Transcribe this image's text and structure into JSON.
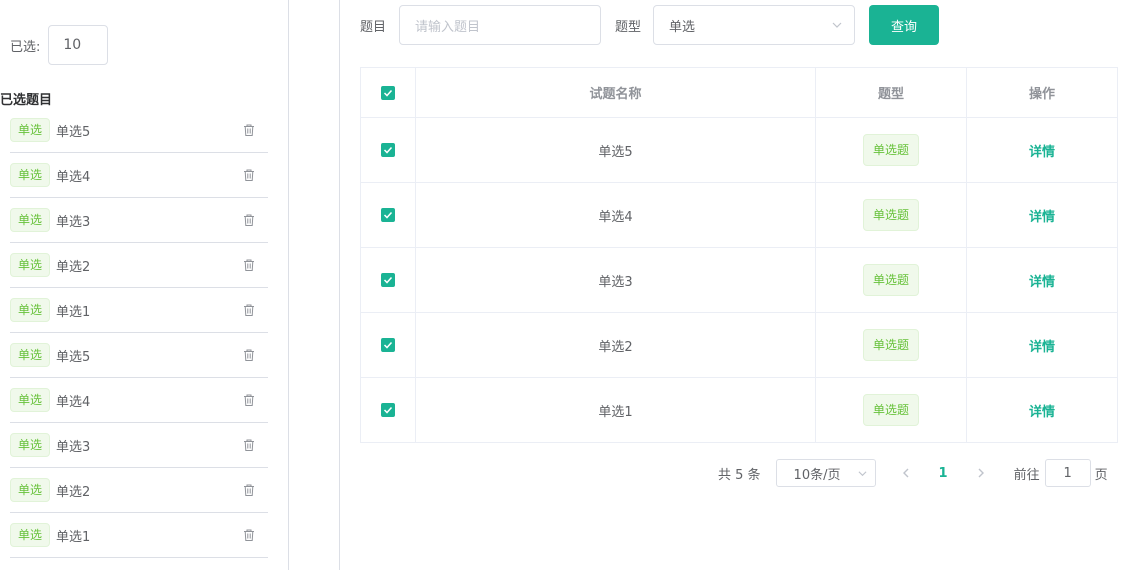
{
  "left": {
    "count_label": "已选:",
    "count_value": "10",
    "section_title": "已选题目",
    "items": [
      {
        "tag": "单选",
        "name": "单选5"
      },
      {
        "tag": "单选",
        "name": "单选4"
      },
      {
        "tag": "单选",
        "name": "单选3"
      },
      {
        "tag": "单选",
        "name": "单选2"
      },
      {
        "tag": "单选",
        "name": "单选1"
      },
      {
        "tag": "单选",
        "name": "单选5"
      },
      {
        "tag": "单选",
        "name": "单选4"
      },
      {
        "tag": "单选",
        "name": "单选3"
      },
      {
        "tag": "单选",
        "name": "单选2"
      },
      {
        "tag": "单选",
        "name": "单选1"
      }
    ]
  },
  "filter": {
    "title_label": "题目",
    "title_placeholder": "请输入题目",
    "type_label": "题型",
    "type_value": "单选",
    "query_button": "查询"
  },
  "table": {
    "columns": [
      "试题名称",
      "题型",
      "操作"
    ],
    "rows": [
      {
        "name": "单选5",
        "type": "单选题",
        "action": "详情",
        "checked": true
      },
      {
        "name": "单选4",
        "type": "单选题",
        "action": "详情",
        "checked": true
      },
      {
        "name": "单选3",
        "type": "单选题",
        "action": "详情",
        "checked": true
      },
      {
        "name": "单选2",
        "type": "单选题",
        "action": "详情",
        "checked": true
      },
      {
        "name": "单选1",
        "type": "单选题",
        "action": "详情",
        "checked": true
      }
    ]
  },
  "pagination": {
    "total": "共 5 条",
    "page_size": "10条/页",
    "current_page": "1",
    "goto_label": "前往",
    "goto_value": "1",
    "page_suffix": "页"
  },
  "colors": {
    "accent": "#1ab394",
    "tag_green": "#67c23a",
    "border": "#dcdfe6"
  },
  "icons": {
    "delete": "trash-icon",
    "dropdown": "chevron-down-icon",
    "prev": "chevron-left-icon",
    "next": "chevron-right-icon",
    "check": "check-icon"
  }
}
